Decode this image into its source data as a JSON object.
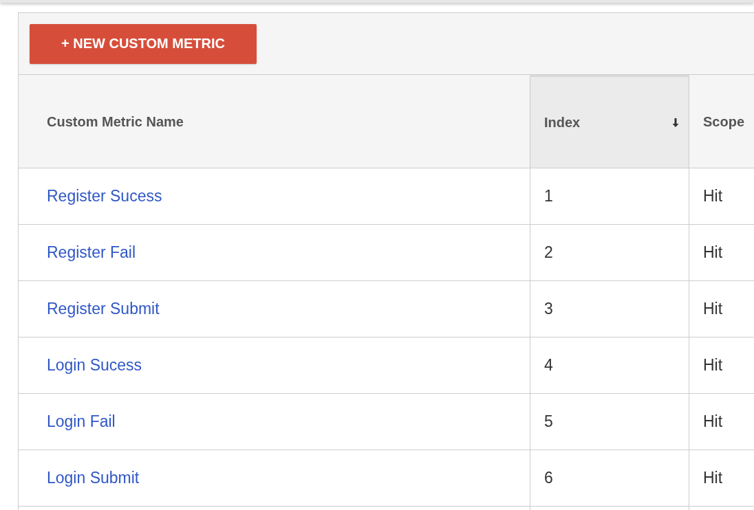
{
  "toolbar": {
    "new_button": "+ NEW CUSTOM METRIC"
  },
  "table": {
    "columns": [
      {
        "label": "Custom Metric Name",
        "sorted": false
      },
      {
        "label": "Index",
        "sorted": true
      },
      {
        "label": "Scope",
        "sorted": false
      }
    ],
    "rows": [
      {
        "name": "Register Sucess",
        "index": "1",
        "scope": "Hit"
      },
      {
        "name": "Register Fail",
        "index": "2",
        "scope": "Hit"
      },
      {
        "name": "Register Submit",
        "index": "3",
        "scope": "Hit"
      },
      {
        "name": "Login Sucess",
        "index": "4",
        "scope": "Hit"
      },
      {
        "name": "Login Fail",
        "index": "5",
        "scope": "Hit"
      },
      {
        "name": "Login Submit",
        "index": "6",
        "scope": "Hit"
      }
    ]
  }
}
